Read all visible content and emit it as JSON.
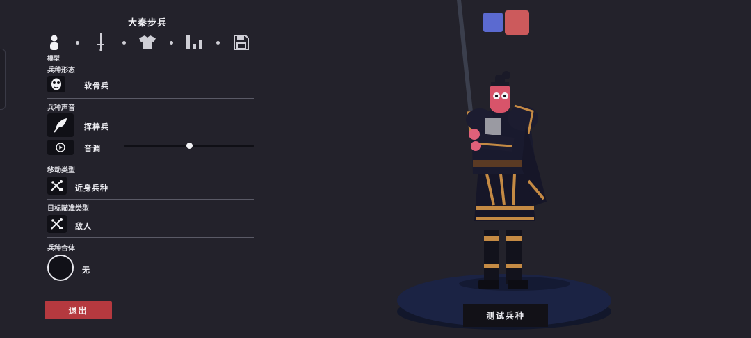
{
  "unit": {
    "name": "大秦步兵"
  },
  "tabs": [
    {
      "icon": "person-icon",
      "label": "模型",
      "selected": true
    },
    {
      "icon": "sword-icon"
    },
    {
      "icon": "shirt-icon"
    },
    {
      "icon": "stats-icon"
    },
    {
      "icon": "save-icon"
    }
  ],
  "sections": {
    "form": {
      "title": "兵种形态",
      "value": "软骨兵",
      "icon": "mask-icon"
    },
    "voice": {
      "title": "兵种声音",
      "value": "挥棒兵",
      "icon": "feather-icon",
      "pitch_label": "音调",
      "pitch_level": 0.5
    },
    "movement": {
      "title": "移动类型",
      "value": "近身兵种",
      "icon": "melee-icon"
    },
    "targeting": {
      "title": "目标瞄准类型",
      "value": "敌人",
      "icon": "target-icon"
    },
    "merge": {
      "title": "兵种合体",
      "value": "无"
    }
  },
  "buttons": {
    "exit": "退出",
    "test_unit": "测试兵种"
  },
  "teams": {
    "blue": "#5b6ad0",
    "red": "#cc5a5c",
    "selected": "red"
  }
}
